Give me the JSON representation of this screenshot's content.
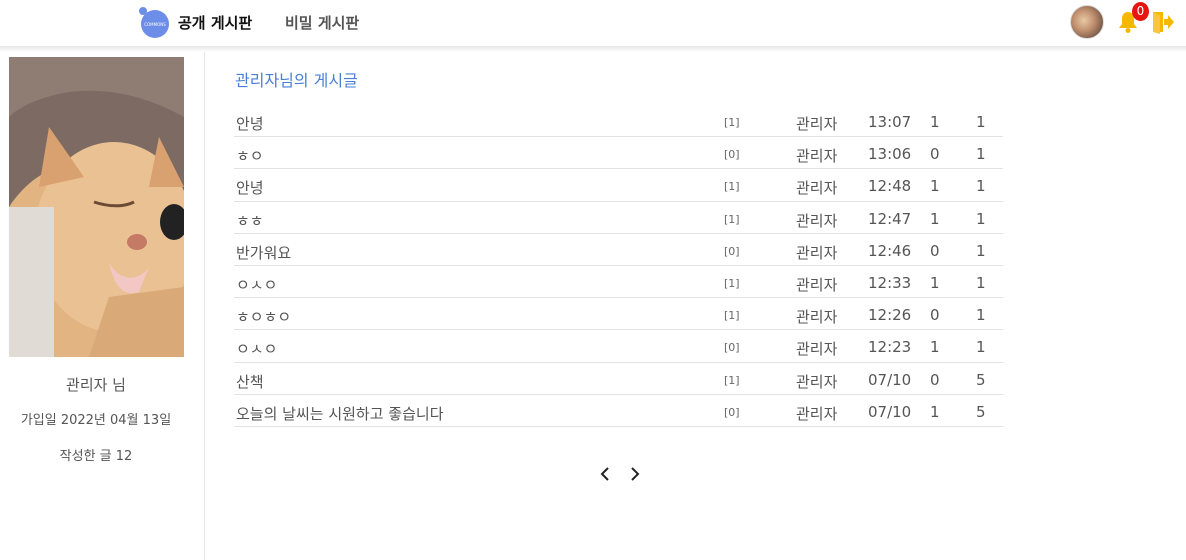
{
  "header": {
    "logo_text": "COMMONS",
    "nav_public": "공개 게시판",
    "nav_secret": "비밀 게시판",
    "notification_count": "0",
    "bell_color": "#f5b800",
    "logout_color": "#f5b800",
    "logo_color": "#6d8ee8"
  },
  "sidebar": {
    "name": "관리자 님",
    "joined": "가입일 2022년 04월 13일",
    "post_count": "작성한 글 12"
  },
  "main": {
    "title": "관리자님의 게시글",
    "posts": [
      {
        "title": "안녕",
        "comments": "[1]",
        "author": "관리자",
        "time": "13:07",
        "likes": "1",
        "views": "1"
      },
      {
        "title": "ㅎㅇ",
        "comments": "[0]",
        "author": "관리자",
        "time": "13:06",
        "likes": "0",
        "views": "1"
      },
      {
        "title": "안녕",
        "comments": "[1]",
        "author": "관리자",
        "time": "12:48",
        "likes": "1",
        "views": "1"
      },
      {
        "title": "ㅎㅎ",
        "comments": "[1]",
        "author": "관리자",
        "time": "12:47",
        "likes": "1",
        "views": "1"
      },
      {
        "title": "반가워요",
        "comments": "[0]",
        "author": "관리자",
        "time": "12:46",
        "likes": "0",
        "views": "1"
      },
      {
        "title": "ㅇㅅㅇ",
        "comments": "[1]",
        "author": "관리자",
        "time": "12:33",
        "likes": "1",
        "views": "1"
      },
      {
        "title": "ㅎㅇㅎㅇ",
        "comments": "[1]",
        "author": "관리자",
        "time": "12:26",
        "likes": "0",
        "views": "1"
      },
      {
        "title": "ㅇㅅㅇ",
        "comments": "[0]",
        "author": "관리자",
        "time": "12:23",
        "likes": "1",
        "views": "1"
      },
      {
        "title": "산책",
        "comments": "[1]",
        "author": "관리자",
        "time": "07/10",
        "likes": "0",
        "views": "5"
      },
      {
        "title": "오늘의 날씨는 시원하고 좋습니다",
        "comments": "[0]",
        "author": "관리자",
        "time": "07/10",
        "likes": "1",
        "views": "5"
      }
    ]
  },
  "pagination": {
    "prev_icon": "chevron-left-icon",
    "next_icon": "chevron-right-icon"
  }
}
